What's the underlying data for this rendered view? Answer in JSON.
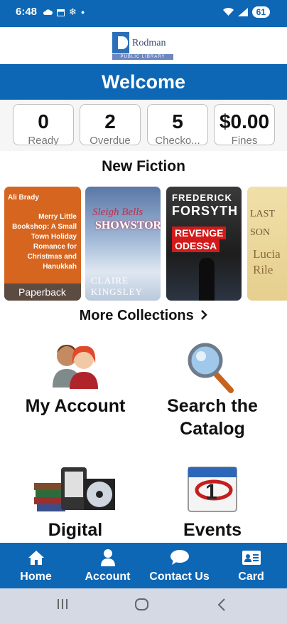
{
  "status_bar": {
    "time": "6:48",
    "battery": "61"
  },
  "logo": {
    "name": "Rodman",
    "subtitle": "PUBLIC LIBRARY"
  },
  "header": {
    "title": "Welcome"
  },
  "stats": [
    {
      "value": "0",
      "label": "Ready"
    },
    {
      "value": "2",
      "label": "Overdue"
    },
    {
      "value": "5",
      "label": "Checko..."
    },
    {
      "value": "$0.00",
      "label": "Fines"
    }
  ],
  "new_fiction": {
    "title": "New Fiction",
    "books": [
      {
        "author": "Ali Brady",
        "title": "Merry Little Bookshop: A Small Town Holiday Romance for Christmas and Hanukkah",
        "format": "Paperback"
      },
      {
        "title_line1": "Sleigh Bells",
        "title_line2": "SHOWSTORMS",
        "author": "CLAIRE KINGSLEY"
      },
      {
        "author_line1": "FREDERICK",
        "author_line2": "FORSYTH",
        "title_line1": "REVENGE",
        "title_line2": "ODESSA"
      },
      {
        "title": "LAST SON",
        "author": "Lucia Rile"
      }
    ],
    "more_label": "More Collections"
  },
  "tiles": {
    "account": "My Account",
    "search_line1": "Search the",
    "search_line2": "Catalog",
    "digital": "Digital",
    "events": "Events"
  },
  "bottom_nav": [
    {
      "label": "Home",
      "icon": "home-icon"
    },
    {
      "label": "Account",
      "icon": "person-icon"
    },
    {
      "label": "Contact Us",
      "icon": "chat-icon"
    },
    {
      "label": "Card",
      "icon": "card-icon"
    }
  ],
  "colors": {
    "primary": "#0d67b5",
    "book1": "#d5651f",
    "revenge_red": "#d21a1a"
  }
}
